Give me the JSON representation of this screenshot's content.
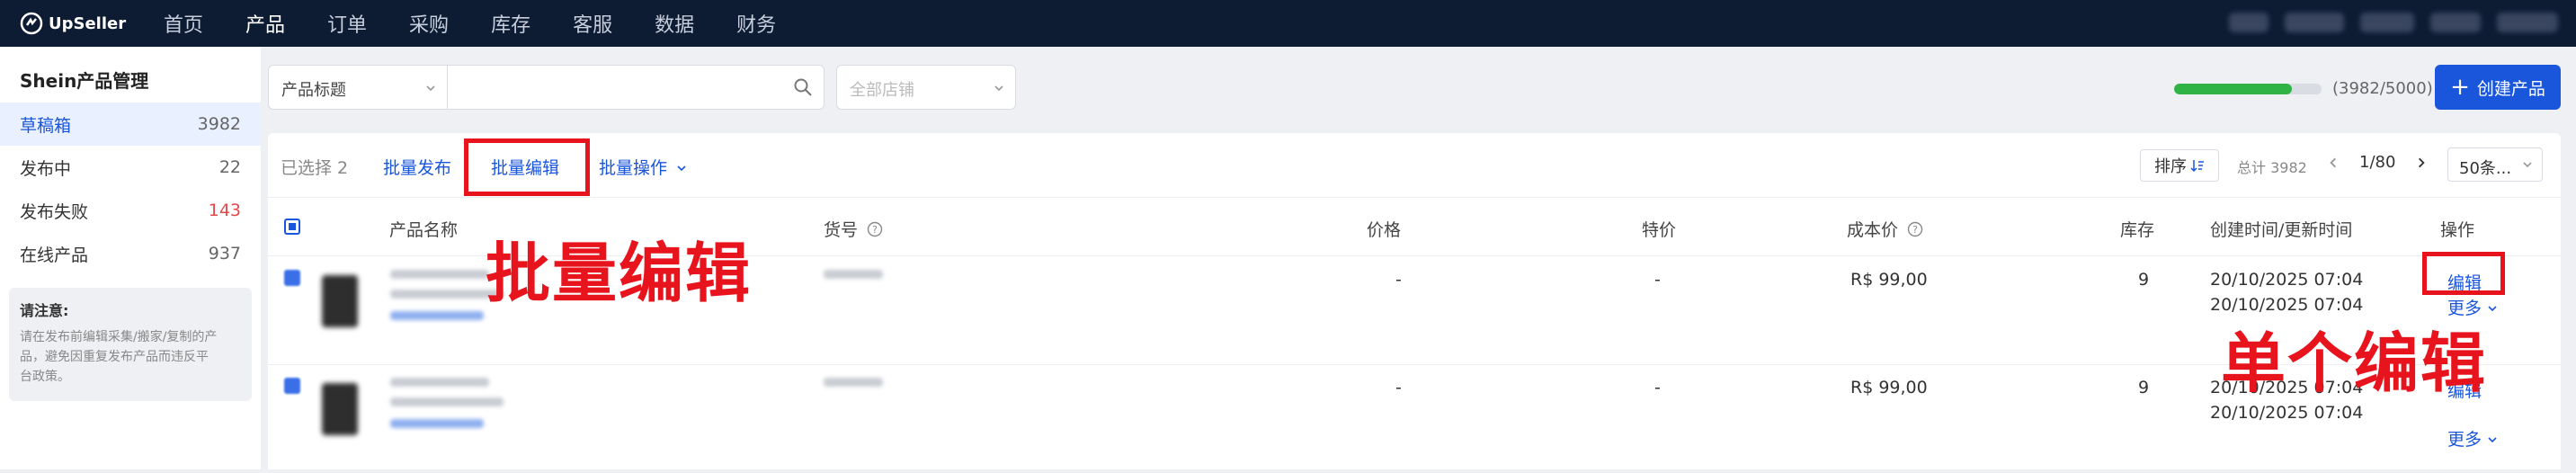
{
  "topbar": {
    "brand": "UpSeller",
    "nav": [
      "首页",
      "产品",
      "订单",
      "采购",
      "库存",
      "客服",
      "数据",
      "财务"
    ],
    "active_nav": 1
  },
  "sidebar": {
    "title": "Shein产品管理",
    "items": [
      {
        "label": "草稿箱",
        "count": "3982",
        "active": true
      },
      {
        "label": "发布中",
        "count": "22",
        "active": false
      },
      {
        "label": "发布失败",
        "count": "143",
        "active": false
      },
      {
        "label": "在线产品",
        "count": "937",
        "active": false
      }
    ],
    "notice_title": "请注意:",
    "notice_lines": [
      "请在发布前编辑采集/搬家/复制的产",
      "品，避免因重复发布产品而违反平",
      "台政策。"
    ]
  },
  "filters": {
    "field_select": "产品标题",
    "search_placeholder": "",
    "shop_select": "全部店铺",
    "quota_text": "(3982/5000)",
    "quota_fraction": 0.7964,
    "create_button": "创建产品"
  },
  "toolbar": {
    "selected": "已选择 2",
    "batch_publish": "批量发布",
    "batch_edit": "批量编辑",
    "batch_ops": "批量操作",
    "sort": "排序",
    "total": "总计 3982",
    "page": "1/80",
    "per_page": "50条..."
  },
  "table": {
    "headers": {
      "name": "产品名称",
      "sku": "货号",
      "price": "价格",
      "special": "特价",
      "cost": "成本价",
      "stock": "库存",
      "time": "创建时间/更新时间",
      "action": "操作"
    },
    "rows": [
      {
        "price": "-",
        "special": "-",
        "cost": "R$ 99,00",
        "stock": "9",
        "created": "20/10/2025 07:04",
        "updated": "20/10/2025 07:04",
        "edit": "编辑",
        "more": "更多"
      },
      {
        "price": "-",
        "special": "-",
        "cost": "R$ 99,00",
        "stock": "9",
        "created": "20/10/2025 07:04",
        "updated": "20/10/2025 07:04",
        "edit": "编辑",
        "more": "更多"
      }
    ]
  },
  "annotations": {
    "batch_edit": "批量编辑",
    "single_edit": "单个编辑"
  },
  "colors": {
    "accent": "#1a56db",
    "annotation_red": "#e8141d",
    "progress": "#2fb344"
  }
}
